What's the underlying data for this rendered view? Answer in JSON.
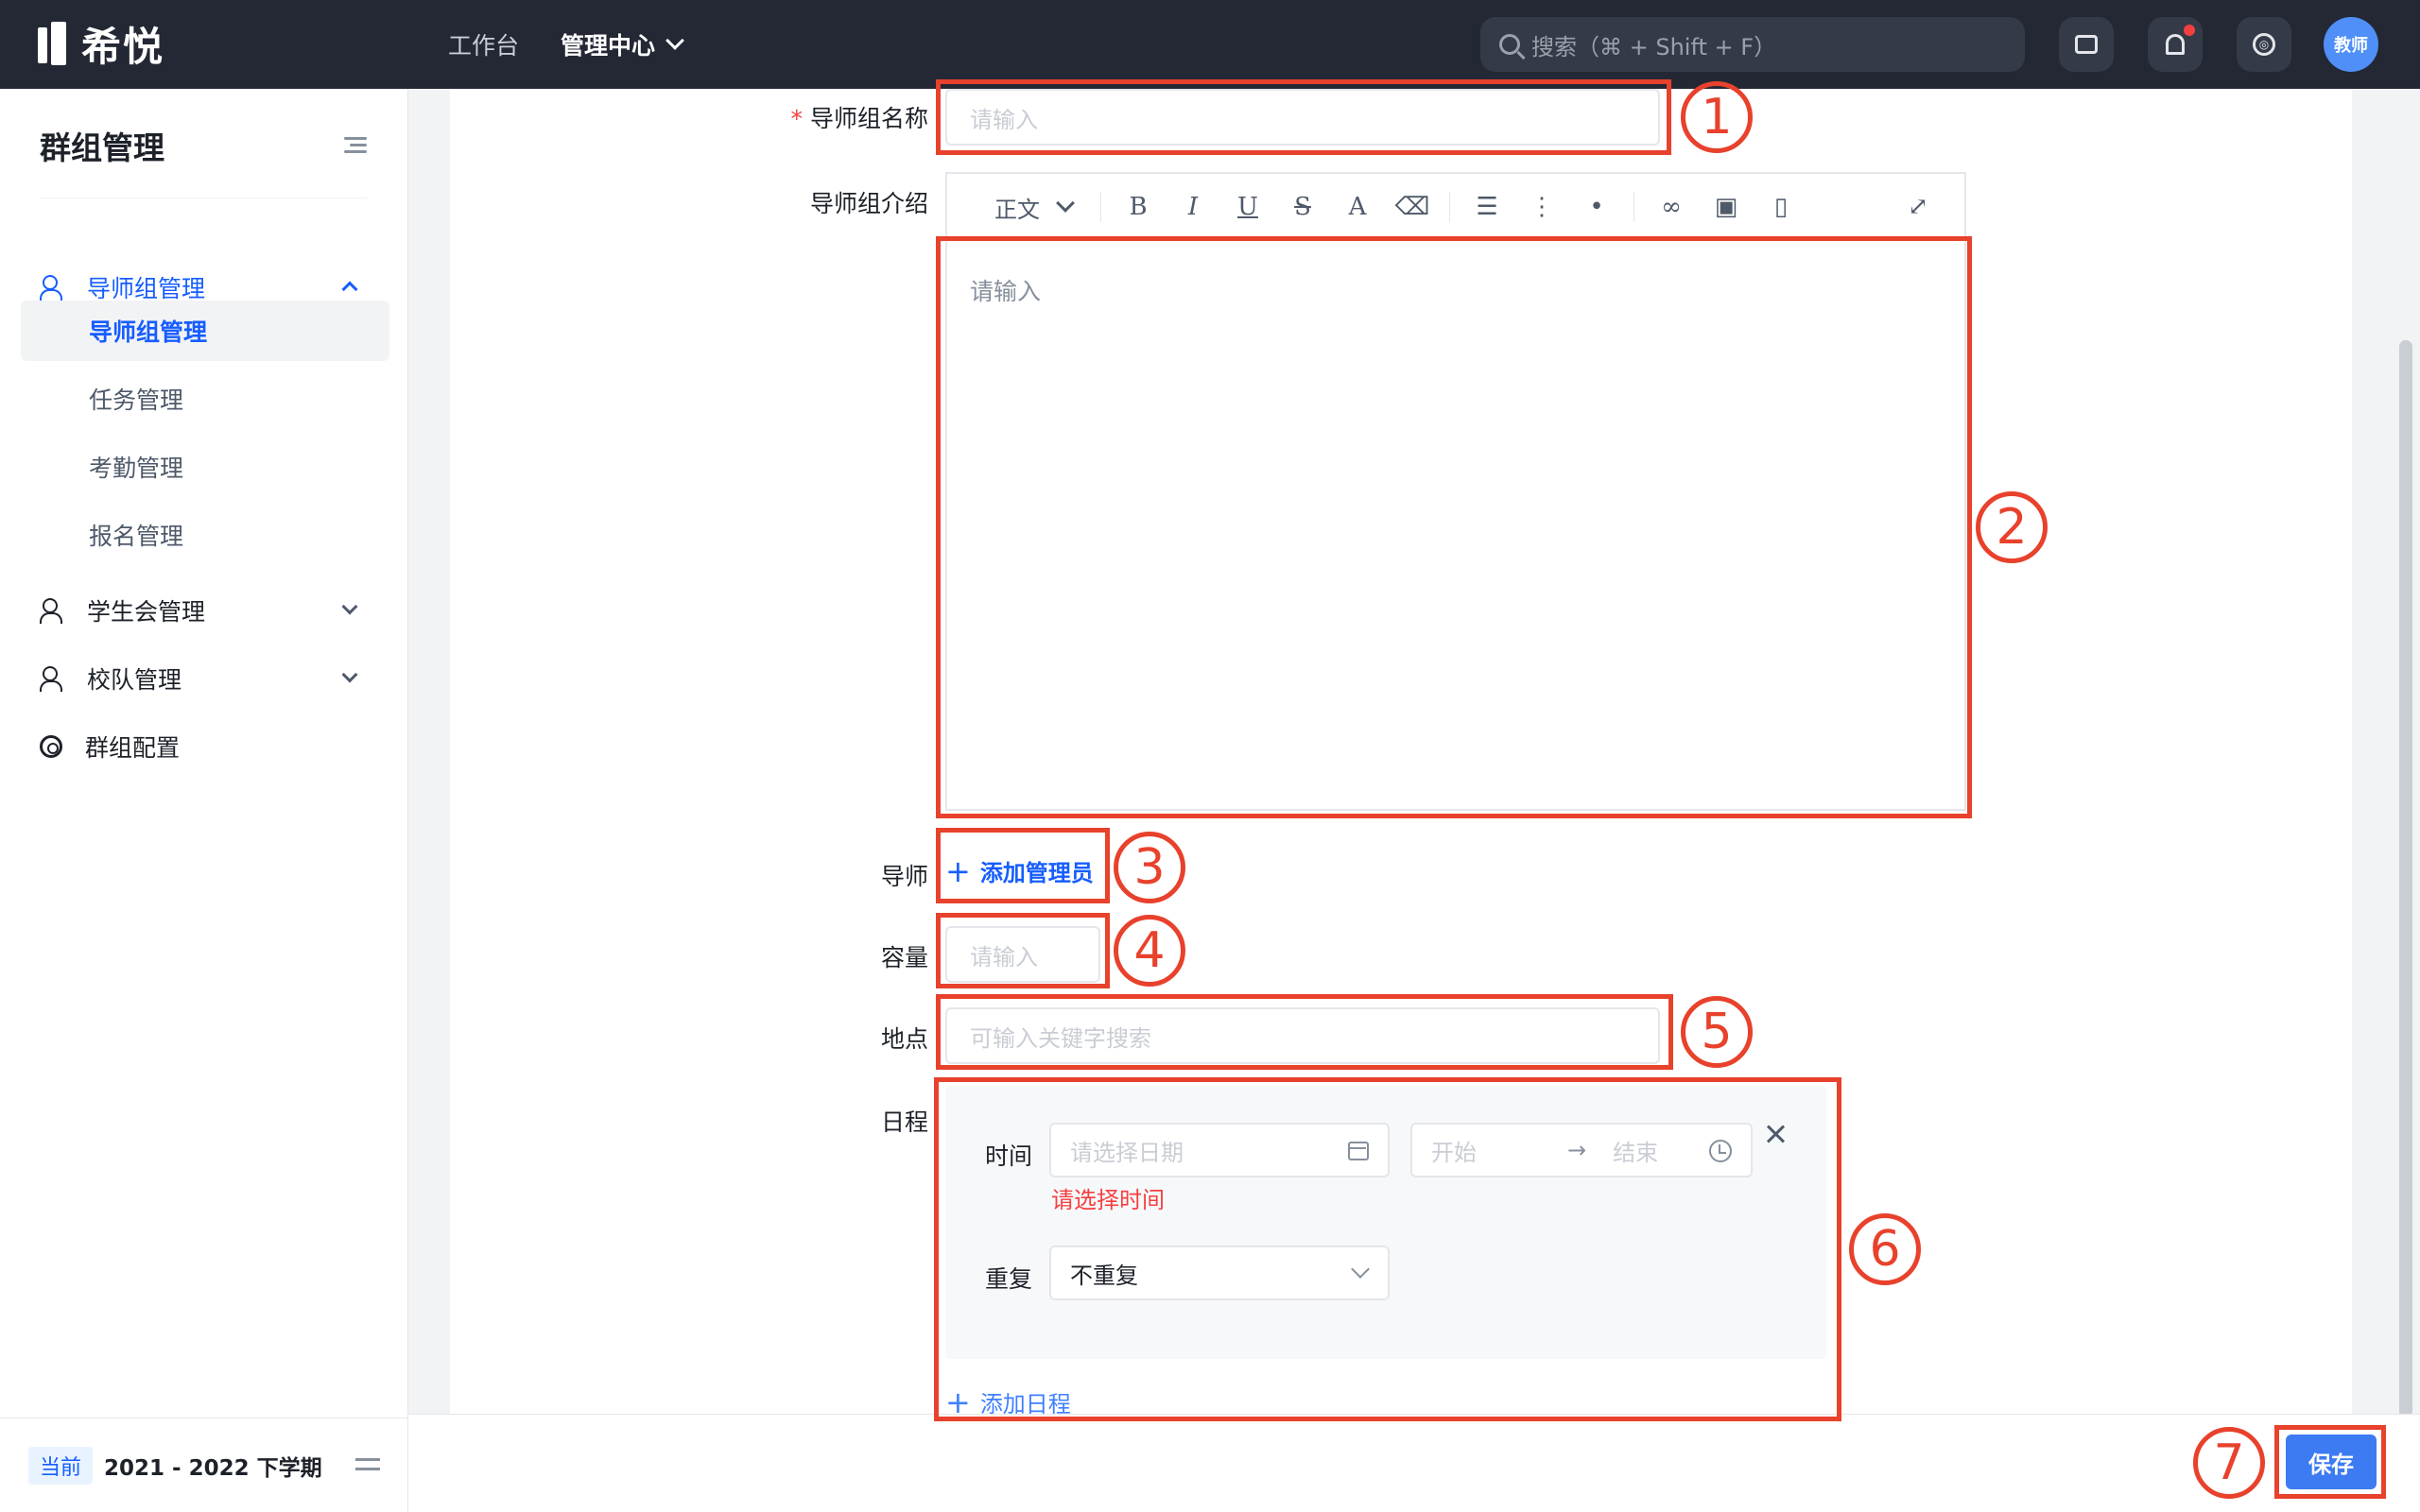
{
  "topbar": {
    "logo_text": "希悦",
    "nav": [
      {
        "label": "工作台"
      },
      {
        "label": "管理中心"
      }
    ],
    "search_placeholder": "搜索（⌘ + Shift + F）",
    "avatar_label": "教师"
  },
  "sidebar": {
    "title": "群组管理",
    "groups": [
      {
        "label": "导师组管理",
        "expanded": true,
        "children": [
          {
            "label": "导师组管理",
            "active": true
          },
          {
            "label": "任务管理"
          },
          {
            "label": "考勤管理"
          },
          {
            "label": "报名管理"
          }
        ]
      },
      {
        "label": "学生会管理",
        "expanded": false
      },
      {
        "label": "校队管理",
        "expanded": false
      },
      {
        "label": "群组配置"
      }
    ],
    "footer": {
      "tag": "当前",
      "term": "2021 - 2022 下学期"
    }
  },
  "form": {
    "name_label": "导师组名称",
    "name_placeholder": "请输入",
    "intro_label": "导师组介绍",
    "toolbar": {
      "style": "正文",
      "bold": "B",
      "italic": "I",
      "underline": "U",
      "strike": "S",
      "color": "A"
    },
    "intro_placeholder": "请输入",
    "mentor_label": "导师",
    "add_admin": "添加管理员",
    "capacity_label": "容量",
    "capacity_placeholder": "请输入",
    "location_label": "地点",
    "location_placeholder": "可输入关键字搜索",
    "schedule_label": "日程",
    "schedule": {
      "time_label": "时间",
      "date_placeholder": "请选择日期",
      "start_placeholder": "开始",
      "arrow": "→",
      "end_placeholder": "结束",
      "error": "请选择时间",
      "repeat_label": "重复",
      "repeat_value": "不重复"
    },
    "add_schedule": "添加日程"
  },
  "actions": {
    "save": "保存"
  },
  "annotations": [
    "1",
    "2",
    "3",
    "4",
    "5",
    "6",
    "7"
  ],
  "colors": {
    "primary": "#165dff",
    "annotation": "#e8412c",
    "topbar": "#232834",
    "error": "#f53f3f"
  }
}
